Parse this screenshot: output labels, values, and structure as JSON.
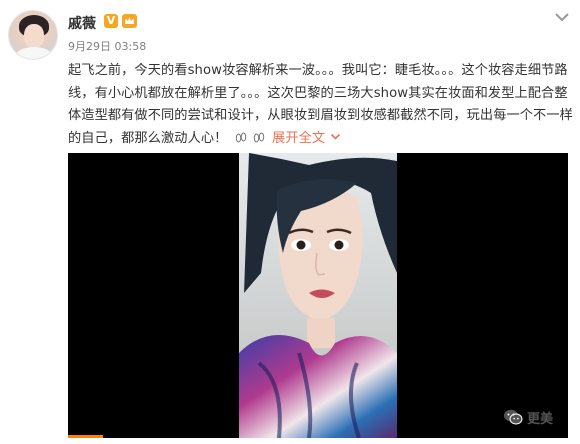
{
  "post": {
    "author": "戚薇",
    "verified_badge": "V",
    "timestamp": "9月29日 03:58",
    "text": "起飞之前，今天的看show妆容解析来一波。。。我叫它：睫毛妆。。。这个妆容走细节路线，有小心机都放在解析里了。。。这次巴黎的三场大show其实在妆面和发型上配合整体造型都有做不同的尝试和设计，从眼妆到眉妆到妆感都截然不同，玩出每一个不一样的自己，都那么激动人心！",
    "expand_label": "展开全文",
    "emojis": [
      "feet-emoji-icon",
      "feet-emoji-icon"
    ]
  },
  "video": {
    "progress": 0.07
  },
  "watermark": {
    "label": "更美"
  },
  "colors": {
    "link": "#eb7350",
    "badge": "#f5a623",
    "progress": "#ff8200"
  }
}
